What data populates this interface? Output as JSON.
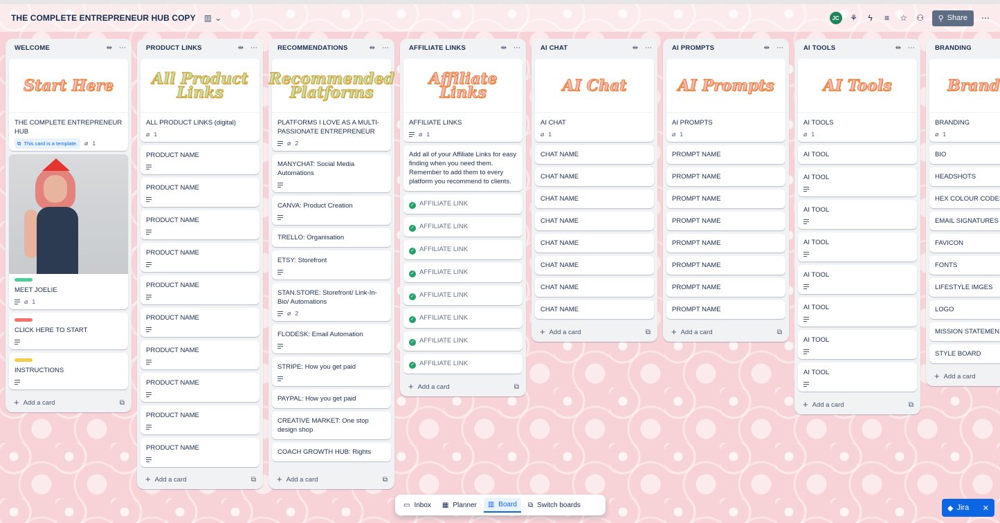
{
  "board": {
    "title": "THE COMPLETE ENTREPRENEUR HUB COPY",
    "share_label": "Share",
    "avatar_initials": "JC"
  },
  "lists": {
    "welcome": {
      "title": "WELCOME",
      "cover_text": "Start Here",
      "card1_title": "THE COMPLETE ENTREPRENEUR HUB",
      "template_badge": "This card is a template.",
      "card1_attach": "1",
      "meet_title": "MEET JOELIE",
      "meet_attach": "1",
      "click_title": "CLICK HERE TO START",
      "instr_title": "INSTRUCTIONS",
      "add_card": "Add a card"
    },
    "product_links": {
      "title": "PRODUCT LINKS",
      "cover_text": "All Product Links",
      "first_title": "ALL PRODUCT LINKS (digital)",
      "first_attach": "1",
      "items": [
        "PRODUCT NAME",
        "PRODUCT NAME",
        "PRODUCT NAME",
        "PRODUCT NAME",
        "PRODUCT NAME",
        "PRODUCT NAME",
        "PRODUCT NAME",
        "PRODUCT NAME",
        "PRODUCT NAME",
        "PRODUCT NAME"
      ],
      "add_card": "Add a card"
    },
    "recommendations": {
      "title": "RECOMMENDATIONS",
      "cover_text": "Recommended Platforms",
      "first_title": "PLATFORMS I LOVE AS A MULTI-PASSIONATE ENTREPRENEUR",
      "first_attach": "2",
      "items": [
        "MANYCHAT: Social Media Automations",
        "CANVA: Product Creation",
        "TRELLO: Organisation",
        "ETSY: Storefront",
        "STAN.STORE: Storefront/ Link-In-Bio/ Automations",
        "FLODESK: Email Automation",
        "STRIPE: How you get paid",
        "PAYPAL: How you get paid",
        "CREATIVE MARKET: One stop design shop",
        "COACH GROWTH HUB: Rights"
      ],
      "stan_attach": "2",
      "add_card": "Add a card"
    },
    "affiliate_links": {
      "title": "AFFILIATE LINKS",
      "cover_text": "Affiliate Links",
      "first_title": "AFFILIATE LINKS",
      "first_attach": "1",
      "note": "Add all of your Affiliate Links for easy finding when you need them. Remember to add them to every platform you recommend to clients.",
      "items": [
        "AFFILIATE LINK",
        "AFFILIATE LINK",
        "AFFILIATE LINK",
        "AFFILIATE LINK",
        "AFFILIATE LINK",
        "AFFILIATE LINK",
        "AFFILIATE LINK",
        "AFFILIATE LINK"
      ],
      "add_card": "Add a card"
    },
    "ai_chat": {
      "title": "AI CHAT",
      "cover_text": "AI Chat",
      "first_title": "AI CHAT",
      "first_attach": "1",
      "items": [
        "CHAT NAME",
        "CHAT NAME",
        "CHAT NAME",
        "CHAT NAME",
        "CHAT NAME",
        "CHAT NAME",
        "CHAT NAME",
        "CHAT NAME"
      ],
      "add_card": "Add a card"
    },
    "ai_prompts": {
      "title": "AI PROMPTS",
      "cover_text": "AI Prompts",
      "first_title": "AI PROMPTS",
      "first_attach": "1",
      "items": [
        "PROMPT NAME",
        "PROMPT NAME",
        "PROMPT NAME",
        "PROMPT NAME",
        "PROMPT NAME",
        "PROMPT NAME",
        "PROMPT NAME",
        "PROMPT NAME"
      ],
      "add_card": "Add a card"
    },
    "ai_tools": {
      "title": "AI TOOLS",
      "cover_text": "AI Tools",
      "first_title": "AI TOOLS",
      "first_attach": "1",
      "items": [
        "AI TOOL",
        "AI TOOL",
        "AI TOOL",
        "AI TOOL",
        "AI TOOL",
        "AI TOOL",
        "AI TOOL",
        "AI TOOL"
      ],
      "add_card": "Add a card"
    },
    "branding": {
      "title": "BRANDING",
      "cover_text": "Brand",
      "first_title": "BRANDING",
      "first_attach": "1",
      "items": [
        "BIO",
        "HEADSHOTS",
        "HEX COLOUR CODES",
        "EMAIL SIGNATURES",
        "FAVICON",
        "FONTS",
        "LIFESTYLE IMGES",
        "LOGO",
        "MISSION STATEMEN",
        "STYLE BOARD"
      ],
      "add_card": "Add a card"
    }
  },
  "bottom_nav": {
    "inbox": "Inbox",
    "planner": "Planner",
    "board": "Board",
    "switch": "Switch boards"
  },
  "jira_label": "Jira",
  "colors": {
    "label_green": "#4bce97",
    "label_red": "#f87168",
    "label_yellow": "#f5cd47",
    "check_green": "#22a06b"
  }
}
